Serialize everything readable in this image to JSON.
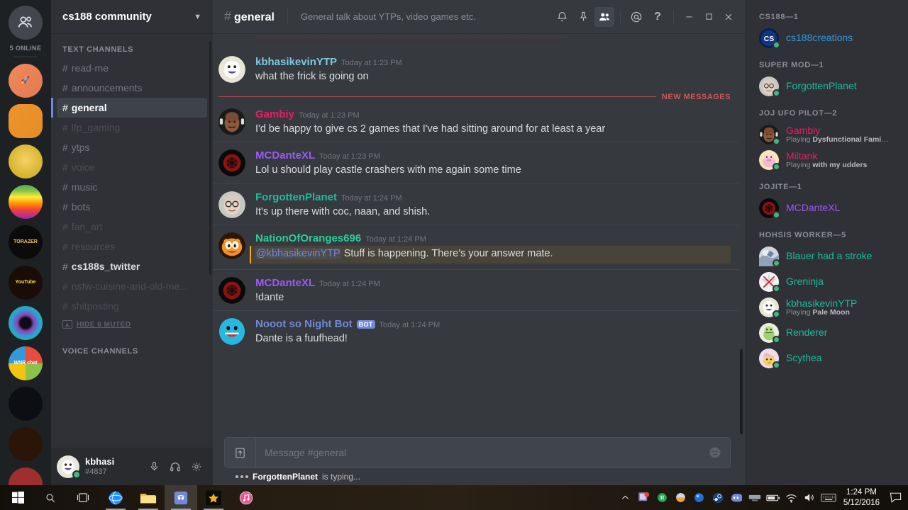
{
  "guild_rail": {
    "online_label": "5 ONLINE",
    "home_icon": "home-friends-icon",
    "servers": [
      {
        "name": "rocket-server",
        "initials": "🚀",
        "bg": "linear-gradient(135deg,#f08a5d,#e07b4f)",
        "shape": "circle",
        "pip": "none"
      },
      {
        "name": "face-server",
        "initials": "",
        "bg": "linear-gradient(135deg,#f0932b,#e58e26)",
        "shape": "square",
        "pip": "wide"
      },
      {
        "name": "fist-server",
        "initials": "",
        "bg": "radial-gradient(circle at 50% 45%,#f6d365,#c8a415)",
        "shape": "circle",
        "pip": "dot"
      },
      {
        "name": "apple-rainbow-server",
        "initials": "",
        "bg": "linear-gradient(180deg,#4caf50,#8bc34a 18%,#ffeb3b 36%,#ff9800 54%,#f44336 72%,#9c27b0 100%)",
        "shape": "circle",
        "pip": "none"
      },
      {
        "name": "torazer-server",
        "initials": "TORAZER",
        "bg": "#0b0b0b",
        "shape": "circle",
        "pip": "dot"
      },
      {
        "name": "youtube-poop-server",
        "initials": "YouTube",
        "bg": "#1a0c06",
        "shape": "circle",
        "pip": "dot"
      },
      {
        "name": "eye-server",
        "initials": "",
        "bg": "radial-gradient(circle at 50% 50%,#120a18 22%,#8e44ad 34%,#3498db 55%,#1abc9c 78%,#ecf0f1 100%)",
        "shape": "circle",
        "pip": "none"
      },
      {
        "name": "wnr-chat-server",
        "initials": "WNR chat",
        "bg": "conic-gradient(#e74c3c 0 25%,#8bc34a 0 50%,#f1c40f 0 75%,#3498db 0 100%)",
        "shape": "circle",
        "pip": "dot"
      },
      {
        "name": "santa-pony-server",
        "initials": "",
        "bg": "#0d0d14",
        "shape": "circle",
        "pip": "dot"
      },
      {
        "name": "fireworks-server",
        "initials": "",
        "bg": "#2a1508",
        "shape": "circle",
        "pip": "dot"
      },
      {
        "name": "red-cap-guy-server",
        "initials": "",
        "bg": "#9d2f2f",
        "shape": "circle",
        "pip": "dot"
      }
    ]
  },
  "sidebar": {
    "server_name": "cs188 community",
    "chevron": "chevron-down-icon",
    "text_channels_label": "TEXT CHANNELS",
    "voice_channels_label": "VOICE CHANNELS",
    "hide_muted_label": "HIDE 6 MUTED",
    "channels": [
      {
        "name": "read-me",
        "state": "normal"
      },
      {
        "name": "announcements",
        "state": "normal"
      },
      {
        "name": "general",
        "state": "active"
      },
      {
        "name": "lfp_gaming",
        "state": "muted"
      },
      {
        "name": "ytps",
        "state": "normal"
      },
      {
        "name": "voice",
        "state": "muted"
      },
      {
        "name": "music",
        "state": "normal"
      },
      {
        "name": "bots",
        "state": "normal"
      },
      {
        "name": "fan_art",
        "state": "muted"
      },
      {
        "name": "resources",
        "state": "muted"
      },
      {
        "name": "cs188s_twitter",
        "state": "unread"
      },
      {
        "name": "nsfw-cuisine-and-old-me...",
        "state": "muted"
      },
      {
        "name": "shitposting",
        "state": "muted"
      }
    ],
    "user": {
      "name": "kbhasi",
      "discriminator": "#4837",
      "mute_icon": "microphone-icon",
      "deafen_icon": "headphones-icon",
      "settings_icon": "gear-icon"
    }
  },
  "chat": {
    "hash": "#",
    "channel": "general",
    "topic": "General talk about YTPs, video games etc.",
    "header_icons": [
      {
        "name": "notifications-bell-icon",
        "glyph": "bell",
        "active": false
      },
      {
        "name": "pinned-messages-icon",
        "glyph": "pin",
        "active": false
      },
      {
        "name": "member-list-toggle-icon",
        "glyph": "members",
        "active": true
      },
      {
        "name": "mentions-icon",
        "glyph": "at",
        "active": false
      },
      {
        "name": "help-icon",
        "glyph": "question",
        "active": false
      }
    ],
    "window_controls": [
      {
        "name": "minimize-button",
        "glyph": "minimize"
      },
      {
        "name": "maximize-button",
        "glyph": "maximize"
      },
      {
        "name": "close-button",
        "glyph": "close"
      }
    ],
    "new_messages_label": "NEW MESSAGES",
    "messages": [
      {
        "author": "kbhasikevinYTP",
        "color": "#7ec8e3",
        "timestamp": "Today at 1:23 PM",
        "text": "what the frick is going on",
        "avatar": "avatar-kbhasikevinytp",
        "bot": false,
        "mention": false
      },
      {
        "author": "Gambiy",
        "color": "#e91e63",
        "timestamp": "Today at 1:23 PM",
        "text": "I'd be happy to give cs 2 games that I've had sitting around for at least a year",
        "avatar": "avatar-gambiy",
        "bot": false,
        "mention": false
      },
      {
        "author": "MCDanteXL",
        "color": "#9b59f6",
        "timestamp": "Today at 1:23 PM",
        "text": "Lol u should play castle crashers with me again some time",
        "avatar": "avatar-mcdantexl",
        "bot": false,
        "mention": false
      },
      {
        "author": "ForgottenPlanet",
        "color": "#1abc9c",
        "timestamp": "Today at 1:24 PM",
        "text": "It's up there with coc, naan, and shish.",
        "avatar": "avatar-forgottenplanet",
        "bot": false,
        "mention": false
      },
      {
        "author": "NationOfOranges696",
        "color": "#2ecc9a",
        "timestamp": "Today at 1:24 PM",
        "mention_text": "@kbhasikevinYTP",
        "text": " Stuff is happening. There's your answer mate.",
        "avatar": "avatar-nationoforanges696",
        "bot": false,
        "mention": true
      },
      {
        "author": "MCDanteXL",
        "color": "#9b59f6",
        "timestamp": "Today at 1:24 PM",
        "text": "!dante",
        "avatar": "avatar-mcdantexl",
        "bot": false,
        "mention": false
      },
      {
        "author": "Nooot so Night Bot",
        "color": "#7289da",
        "timestamp": "Today at 1:24 PM",
        "text": "Dante is a fuufhead!",
        "avatar": "avatar-nooot-so-night-bot",
        "bot": true,
        "bot_label": "BOT",
        "mention": false
      }
    ],
    "composer": {
      "placeholder": "Message #general",
      "upload_icon": "upload-icon",
      "emoji_icon": "emoji-icon"
    },
    "typing": {
      "user": "ForgottenPlanet",
      "suffix": " is typing..."
    }
  },
  "members": {
    "groups": [
      {
        "label": "CS188—1",
        "people": [
          {
            "name": "cs188creations",
            "color": "#3498db",
            "game": "",
            "avatar": "avatar-cs188creations",
            "status": "online"
          }
        ]
      },
      {
        "label": "SUPER MOD—1",
        "people": [
          {
            "name": "ForgottenPlanet",
            "color": "#1abc9c",
            "game": "",
            "avatar": "avatar-forgottenplanet",
            "status": "online"
          }
        ]
      },
      {
        "label": "JOJ UFO PILOT—2",
        "people": [
          {
            "name": "Gambiy",
            "color": "#e91e63",
            "game_prefix": "Playing ",
            "game": "Dysfunctional Famil...",
            "avatar": "avatar-gambiy",
            "status": "online"
          },
          {
            "name": "Miltank",
            "color": "#e91e63",
            "game_prefix": "Playing ",
            "game": "with my udders",
            "avatar": "avatar-miltank",
            "status": "online"
          }
        ]
      },
      {
        "label": "JOJITE—1",
        "people": [
          {
            "name": "MCDanteXL",
            "color": "#9b59f6",
            "game": "",
            "avatar": "avatar-mcdantexl",
            "status": "online"
          }
        ]
      },
      {
        "label": "HOHSIS WORKER—5",
        "people": [
          {
            "name": "Blauer had a stroke",
            "color": "#1abc9c",
            "game": "",
            "avatar": "avatar-blauer",
            "status": "online"
          },
          {
            "name": "Greninja",
            "color": "#1abc9c",
            "game": "",
            "avatar": "avatar-greninja",
            "status": "online"
          },
          {
            "name": "kbhasikevinYTP",
            "color": "#1abc9c",
            "game_prefix": "Playing ",
            "game": "Pale Moon",
            "avatar": "avatar-kbhasikevinytp",
            "status": "online"
          },
          {
            "name": "Renderer",
            "color": "#1abc9c",
            "game": "",
            "avatar": "avatar-renderer",
            "status": "online"
          },
          {
            "name": "Scythea",
            "color": "#1abc9c",
            "game": "",
            "avatar": "avatar-scythea",
            "status": "online"
          }
        ]
      }
    ]
  },
  "taskbar": {
    "start_icon": "windows-start-icon",
    "search_icon": "search-icon",
    "taskview_icon": "task-view-icon",
    "apps": [
      {
        "name": "internet-explorer-taskbar-icon",
        "running": true,
        "active": false
      },
      {
        "name": "file-explorer-taskbar-icon",
        "running": true,
        "active": false
      },
      {
        "name": "discord-taskbar-icon",
        "running": true,
        "active": true
      },
      {
        "name": "star-app-taskbar-icon",
        "running": true,
        "active": false
      },
      {
        "name": "itunes-taskbar-icon",
        "running": false,
        "active": false
      }
    ],
    "tray": [
      {
        "name": "show-hidden-icons-chevron"
      },
      {
        "name": "app-notification-tray-icon"
      },
      {
        "name": "green-circle-tray-icon"
      },
      {
        "name": "orange-circle-tray-icon"
      },
      {
        "name": "blue-circle-tray-icon"
      },
      {
        "name": "steam-tray-icon"
      },
      {
        "name": "discord-tray-icon"
      },
      {
        "name": "grey-bar-tray-icon"
      },
      {
        "name": "battery-icon"
      },
      {
        "name": "wifi-icon"
      },
      {
        "name": "volume-icon"
      },
      {
        "name": "keyboard-icon"
      }
    ],
    "clock_time": "1:24 PM",
    "clock_date": "5/12/2016",
    "action_center_icon": "action-center-icon"
  }
}
